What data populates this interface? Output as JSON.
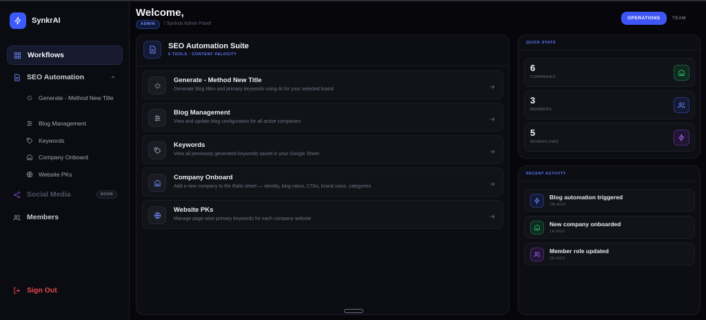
{
  "app": {
    "name": "SynkrAI",
    "accent": "#3e56f5"
  },
  "sidebar": {
    "items": [
      {
        "label": "Workflows",
        "icon": "grid-icon"
      },
      {
        "label": "SEO Automation",
        "icon": "document-icon"
      },
      {
        "label": "Social Media",
        "icon": "share-icon",
        "badge": "SOON"
      },
      {
        "label": "Members",
        "icon": "users-icon"
      }
    ],
    "sub_items": [
      {
        "label": "Generate - Method New Title",
        "icon": "sparkle-icon"
      },
      {
        "label": "Blog Management",
        "icon": "sliders-icon"
      },
      {
        "label": "Keywords",
        "icon": "tag-icon"
      },
      {
        "label": "Company Onboard",
        "icon": "building-icon"
      },
      {
        "label": "Website PKs",
        "icon": "globe-icon"
      }
    ],
    "sign_out": "Sign Out"
  },
  "header": {
    "welcome": "Welcome,",
    "role": "ADMIN",
    "breadcrumb": "/ Synkrai Admin Panel",
    "tabs": [
      {
        "label": "OPERATIONS",
        "active": true
      },
      {
        "label": "TEAM",
        "active": false
      }
    ]
  },
  "suite": {
    "title": "SEO Automation Suite",
    "subtitle": "5 TOOLS · CONTENT VELOCITY",
    "tools": [
      {
        "name": "Generate - Method New Title",
        "desc": "Generate blog titles and primary keywords using AI for your selected brand",
        "icon": "sparkle-icon"
      },
      {
        "name": "Blog Management",
        "desc": "View and update blog configuration for all active companies",
        "icon": "sliders-icon"
      },
      {
        "name": "Keywords",
        "desc": "View all previously generated keywords saved in your Google Sheet",
        "icon": "tag-icon"
      },
      {
        "name": "Company Onboard",
        "desc": "Add a new company to the Ratio sheet — identity, blog ratios, CTAs, brand voice, categories",
        "icon": "building-icon"
      },
      {
        "name": "Website PKs",
        "desc": "Manage page-wise primary keywords for each company website",
        "icon": "globe-icon"
      }
    ]
  },
  "quick_stats": {
    "label": "QUICK STATS",
    "stats": [
      {
        "value": "6",
        "label": "COMPANIES",
        "icon": "building-icon",
        "color": "#2fbf71"
      },
      {
        "value": "3",
        "label": "MEMBERS",
        "icon": "users-icon",
        "color": "#5c7bff"
      },
      {
        "value": "5",
        "label": "WORKFLOWS",
        "icon": "bolt-icon",
        "color": "#a86bff"
      }
    ]
  },
  "recent_activity": {
    "label": "RECENT ACTIVITY",
    "items": [
      {
        "title": "Blog automation triggered",
        "time": "2M AGO",
        "icon": "bolt-icon"
      },
      {
        "title": "New company onboarded",
        "time": "1H AGO",
        "icon": "building-icon"
      },
      {
        "title": "Member role updated",
        "time": "3H AGO",
        "icon": "users-icon"
      }
    ]
  }
}
